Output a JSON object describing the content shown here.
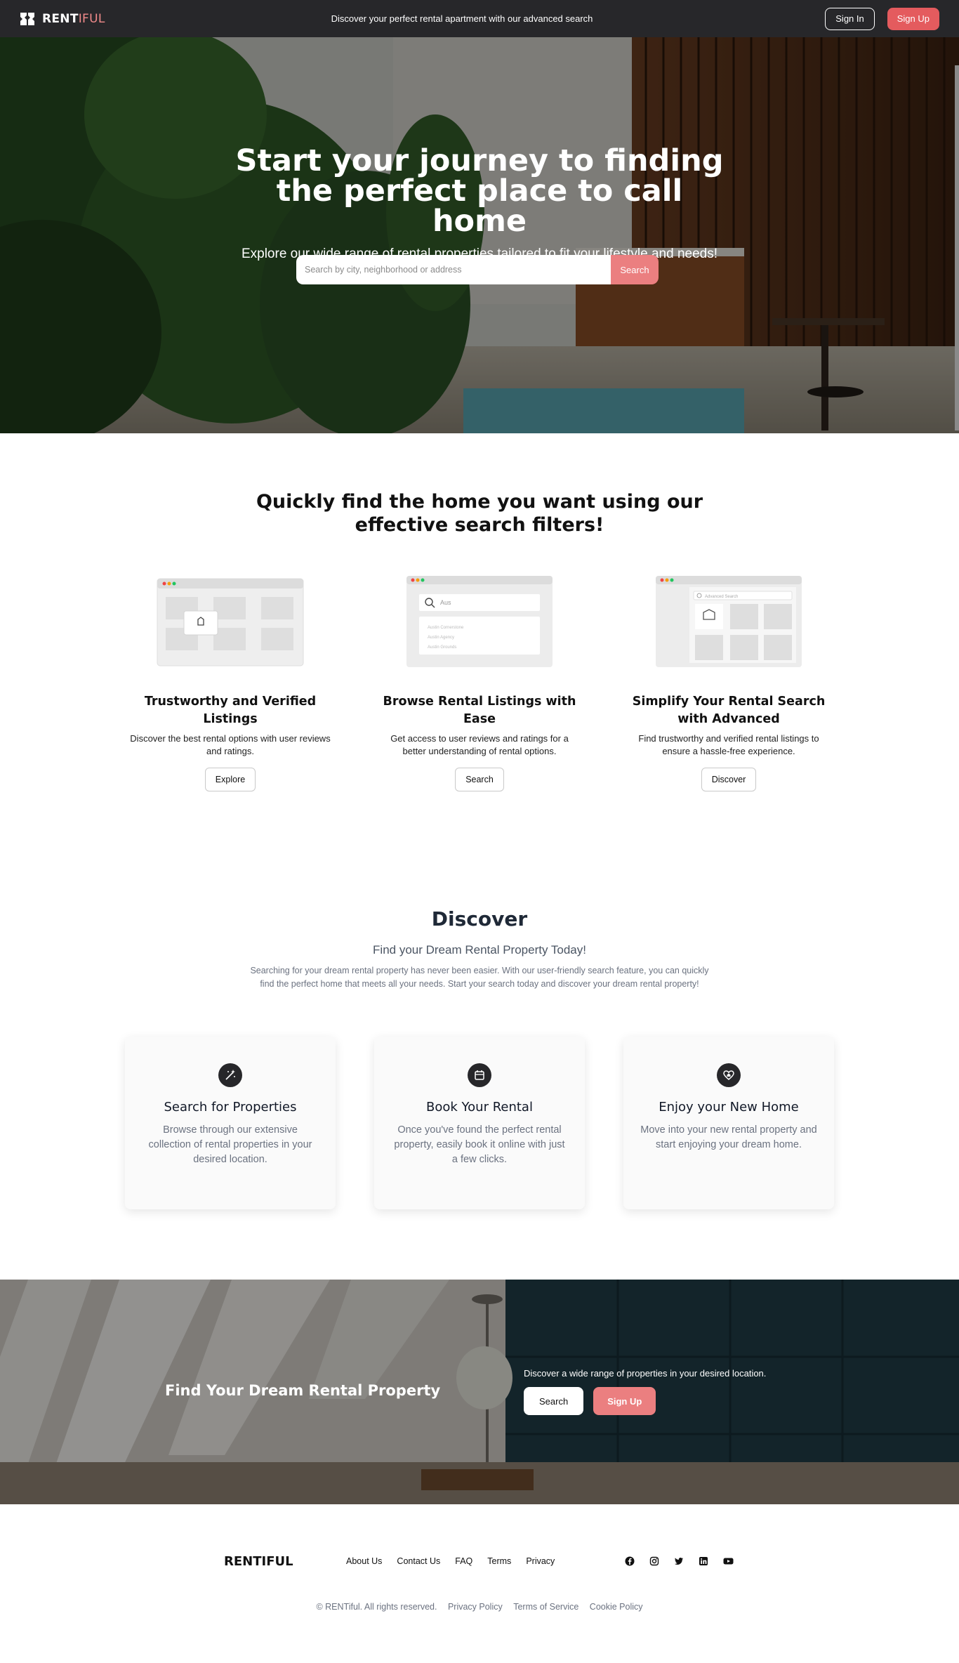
{
  "nav": {
    "brand_part1": "RENT",
    "brand_part2": "IFUL",
    "tagline": "Discover your perfect rental apartment with our advanced search",
    "sign_in": "Sign In",
    "sign_up": "Sign Up"
  },
  "hero": {
    "title": "Start your journey to finding the perfect place to call home",
    "subtitle": "Explore our wide range of rental properties tailored to fit your lifestyle and needs!",
    "search_placeholder": "Search by city, neighborhood or address",
    "search_button": "Search"
  },
  "features": {
    "title": "Quickly find the home you want using our effective search filters!",
    "items": [
      {
        "title": "Trustworthy and Verified Listings",
        "description": "Discover the best rental options with user reviews and ratings.",
        "button": "Explore"
      },
      {
        "title": "Browse Rental Listings with Ease",
        "description": "Get access to user reviews and ratings for a better understanding of rental options.",
        "button": "Search",
        "illustration_search_text": "Aus",
        "illustration_lines": [
          "Austin Cornerstone",
          "Austin Agency",
          "Austin Grounds"
        ]
      },
      {
        "title": "Simplify Your Rental Search with Advanced",
        "description": "Find trustworthy and verified rental listings to ensure a hassle-free experience.",
        "button": "Discover",
        "illustration_search_text": "Advanced Search"
      }
    ]
  },
  "discover": {
    "title": "Discover",
    "subtitle": "Find your Dream Rental Property Today!",
    "description": "Searching for your dream rental property has never been easier. With our user-friendly search feature, you can quickly find the perfect home that meets all your needs. Start your search today and discover your dream rental property!",
    "steps": [
      {
        "icon": "wand-icon",
        "title": "Search for Properties",
        "description": "Browse through our extensive collection of rental properties in your desired location."
      },
      {
        "icon": "calendar-icon",
        "title": "Book Your Rental",
        "description": "Once you've found the perfect rental property, easily book it online with just a few clicks."
      },
      {
        "icon": "heart-home-icon",
        "title": "Enjoy your New Home",
        "description": "Move into your new rental property and start enjoying your dream home."
      }
    ]
  },
  "cta": {
    "title": "Find Your Dream Rental Property",
    "text": "Discover a wide range of properties in your desired location.",
    "search_button": "Search",
    "signup_button": "Sign Up"
  },
  "footer": {
    "brand": "RENTIFUL",
    "links": [
      "About Us",
      "Contact Us",
      "FAQ",
      "Terms",
      "Privacy"
    ],
    "social": [
      "facebook-icon",
      "instagram-icon",
      "twitter-icon",
      "linkedin-icon",
      "youtube-icon"
    ],
    "copyright": "© RENTiful. All rights reserved.",
    "legal_links": [
      "Privacy Policy",
      "Terms of Service",
      "Cookie Policy"
    ]
  },
  "colors": {
    "nav_bg": "#27272a",
    "accent": "#e45b5e",
    "accent_light": "#eb7f80",
    "text_dark": "#111111",
    "text_muted": "#6b7280"
  }
}
